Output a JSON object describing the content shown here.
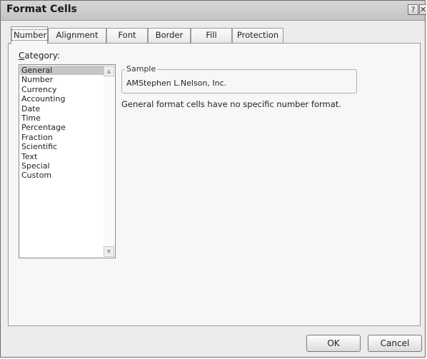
{
  "window": {
    "title": "Format Cells",
    "help_glyph": "?",
    "close_glyph": "✕"
  },
  "tabs": [
    {
      "label": "Number",
      "active": true
    },
    {
      "label": "Alignment",
      "active": false
    },
    {
      "label": "Font",
      "active": false
    },
    {
      "label": "Border",
      "active": false
    },
    {
      "label": "Fill",
      "active": false
    },
    {
      "label": "Protection",
      "active": false
    }
  ],
  "category": {
    "label_prefix": "C",
    "label_rest": "ategory:",
    "items": [
      "General",
      "Number",
      "Currency",
      "Accounting",
      "Date",
      "Time",
      "Percentage",
      "Fraction",
      "Scientific",
      "Text",
      "Special",
      "Custom"
    ],
    "selected": "General"
  },
  "sample": {
    "legend": "Sample",
    "value": "AMStephen L.Nelson, Inc."
  },
  "description": "General format cells have no specific number format.",
  "buttons": {
    "ok": "OK",
    "cancel": "Cancel"
  },
  "icons": {
    "scroll_up": "scroll-up-arrow-icon",
    "scroll_down": "scroll-down-arrow-icon"
  }
}
